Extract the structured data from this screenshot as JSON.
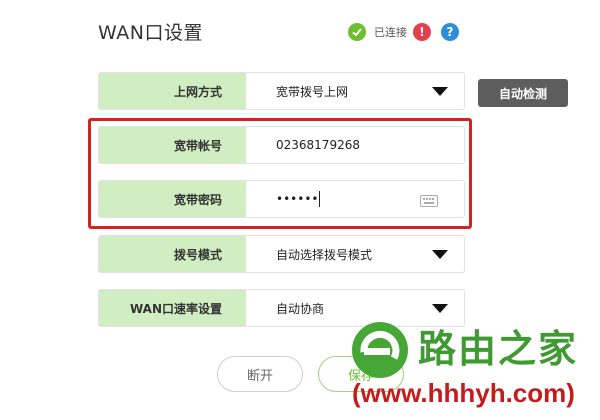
{
  "page": {
    "title": "WAN口设置"
  },
  "status": {
    "connected_text": "已连接",
    "warn_glyph": "!",
    "help_glyph": "?"
  },
  "form": {
    "rows": [
      {
        "label": "上网方式",
        "value": "宽带拨号上网",
        "type": "select"
      },
      {
        "label": "宽带帐号",
        "value": "02368179268",
        "type": "text"
      },
      {
        "label": "宽带密码",
        "value": "••••••",
        "type": "password"
      },
      {
        "label": "拨号模式",
        "value": "自动选择拨号模式",
        "type": "select"
      },
      {
        "label": "WAN口速率设置",
        "value": "自动协商",
        "type": "select"
      }
    ]
  },
  "buttons": {
    "detect": "自动检测",
    "disconnect": "断开",
    "save": "保存"
  },
  "watermark": {
    "brand": "路由之家",
    "url": "(www.hhhyh.com)"
  },
  "colors": {
    "label_bg": "#d0eec2",
    "highlight": "#d8201c",
    "ok": "#6cbf2f",
    "warn": "#e3404e",
    "help": "#2e8ed8",
    "detect_bg": "#5d5d5d",
    "brand_green": "#3f9a32",
    "url_red": "#c61b1b"
  },
  "icons": [
    "check-circle-icon",
    "warning-icon",
    "help-icon",
    "dropdown-arrow-icon",
    "keyboard-icon",
    "router-logo-icon"
  ]
}
